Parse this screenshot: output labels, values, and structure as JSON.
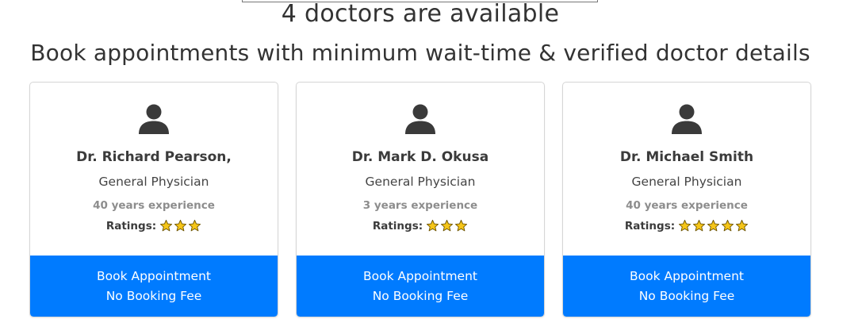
{
  "header": {
    "count_title": "4 doctors are available",
    "subtitle": "Book appointments with minimum wait-time & verified doctor details"
  },
  "doctors": [
    {
      "name": "Dr. Richard Pearson,",
      "specialty": "General Physician",
      "experience": "40 years experience",
      "ratings_label": "Ratings:",
      "stars": 3,
      "button_line1": "Book Appointment",
      "button_line2": "No Booking Fee"
    },
    {
      "name": "Dr. Mark D. Okusa",
      "specialty": "General Physician",
      "experience": "3 years experience",
      "ratings_label": "Ratings:",
      "stars": 3,
      "button_line1": "Book Appointment",
      "button_line2": "No Booking Fee"
    },
    {
      "name": "Dr. Michael Smith",
      "specialty": "General Physician",
      "experience": "40 years experience",
      "ratings_label": "Ratings:",
      "stars": 5,
      "button_line1": "Book Appointment",
      "button_line2": "No Booking Fee"
    }
  ],
  "colors": {
    "button": "#007bff",
    "star_fill": "#f5c518",
    "avatar": "#3a3a3a"
  },
  "icons": {
    "avatar": "user-icon",
    "star": "star-icon"
  }
}
